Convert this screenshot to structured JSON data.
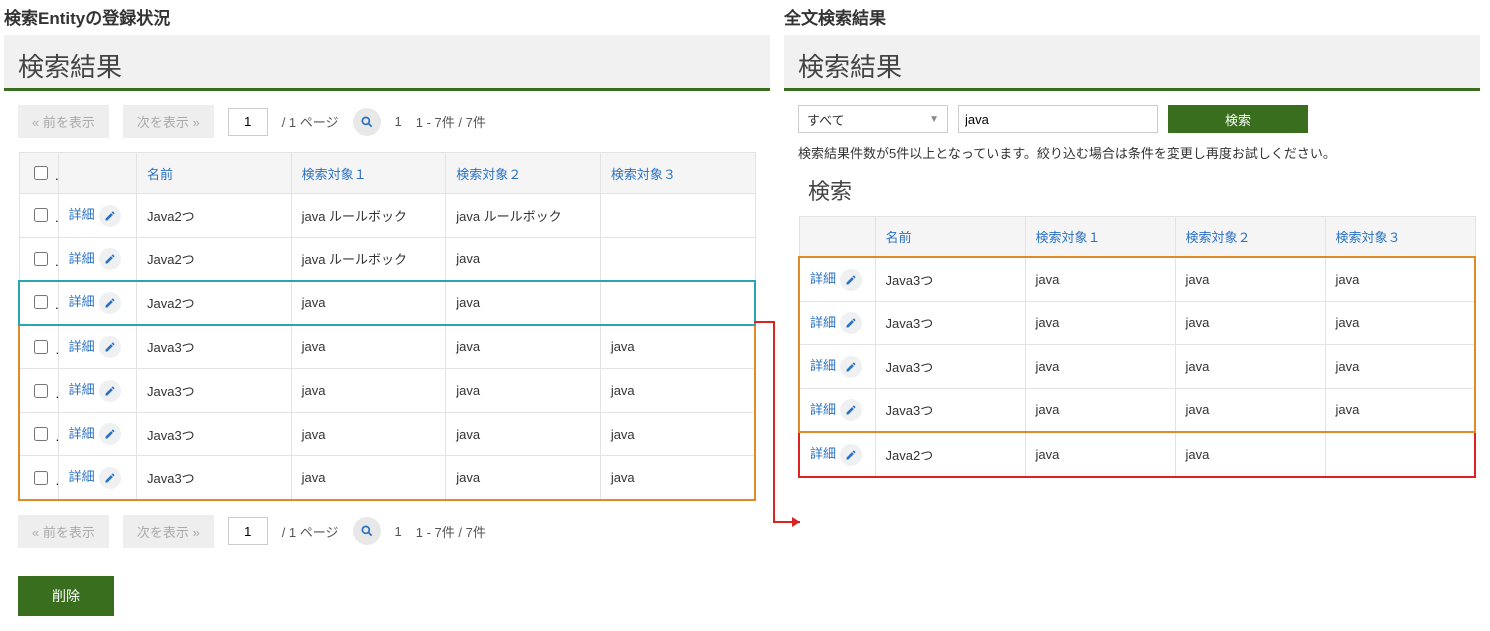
{
  "left": {
    "section_title": "検索Entityの登録状況",
    "panel_title": "検索結果",
    "pager": {
      "prev": "«  前を表示",
      "next": "次を表示  »",
      "page_input": "1",
      "page_of": "/  1 ページ",
      "count_left": "1",
      "count_right": "1 - 7件 / 7件"
    },
    "headers": {
      "name": "名前",
      "t1": "検索対象１",
      "t2": "検索対象２",
      "t3": "検索対象３"
    },
    "detail_label": "詳細",
    "rows": [
      {
        "name": "Java2つ",
        "t1": "java ルールボック",
        "t2": "java ルールボック",
        "t3": "",
        "hl": ""
      },
      {
        "name": "Java2つ",
        "t1": "java ルールボック",
        "t2": "java",
        "t3": "",
        "hl": ""
      },
      {
        "name": "Java2つ",
        "t1": "java",
        "t2": "java",
        "t3": "",
        "hl": "cyan"
      },
      {
        "name": "Java3つ",
        "t1": "java",
        "t2": "java",
        "t3": "java",
        "hl": "orange"
      },
      {
        "name": "Java3つ",
        "t1": "java",
        "t2": "java",
        "t3": "java",
        "hl": "orange"
      },
      {
        "name": "Java3つ",
        "t1": "java",
        "t2": "java",
        "t3": "java",
        "hl": "orange"
      },
      {
        "name": "Java3つ",
        "t1": "java",
        "t2": "java",
        "t3": "java",
        "hl": "orange"
      }
    ],
    "delete_label": "削除"
  },
  "right": {
    "section_title": "全文検索結果",
    "panel_title": "検索結果",
    "filter_select": "すべて",
    "filter_text": "java",
    "search_label": "検索",
    "notice": "検索結果件数が5件以上となっています。絞り込む場合は条件を変更し再度お試しください。",
    "sub_title": "検索",
    "headers": {
      "name": "名前",
      "t1": "検索対象１",
      "t2": "検索対象２",
      "t3": "検索対象３"
    },
    "detail_label": "詳細",
    "rows": [
      {
        "name": "Java3つ",
        "t1": "java",
        "t2": "java",
        "t3": "java",
        "hl": "orange"
      },
      {
        "name": "Java3つ",
        "t1": "java",
        "t2": "java",
        "t3": "java",
        "hl": "orange"
      },
      {
        "name": "Java3つ",
        "t1": "java",
        "t2": "java",
        "t3": "java",
        "hl": "orange"
      },
      {
        "name": "Java3つ",
        "t1": "java",
        "t2": "java",
        "t3": "java",
        "hl": "orange"
      },
      {
        "name": "Java2つ",
        "t1": "java",
        "t2": "java",
        "t3": "",
        "hl": "red"
      }
    ]
  },
  "icons": {
    "search": "search-icon",
    "pencil": "pencil-icon",
    "caret": "chevron-down-icon"
  }
}
